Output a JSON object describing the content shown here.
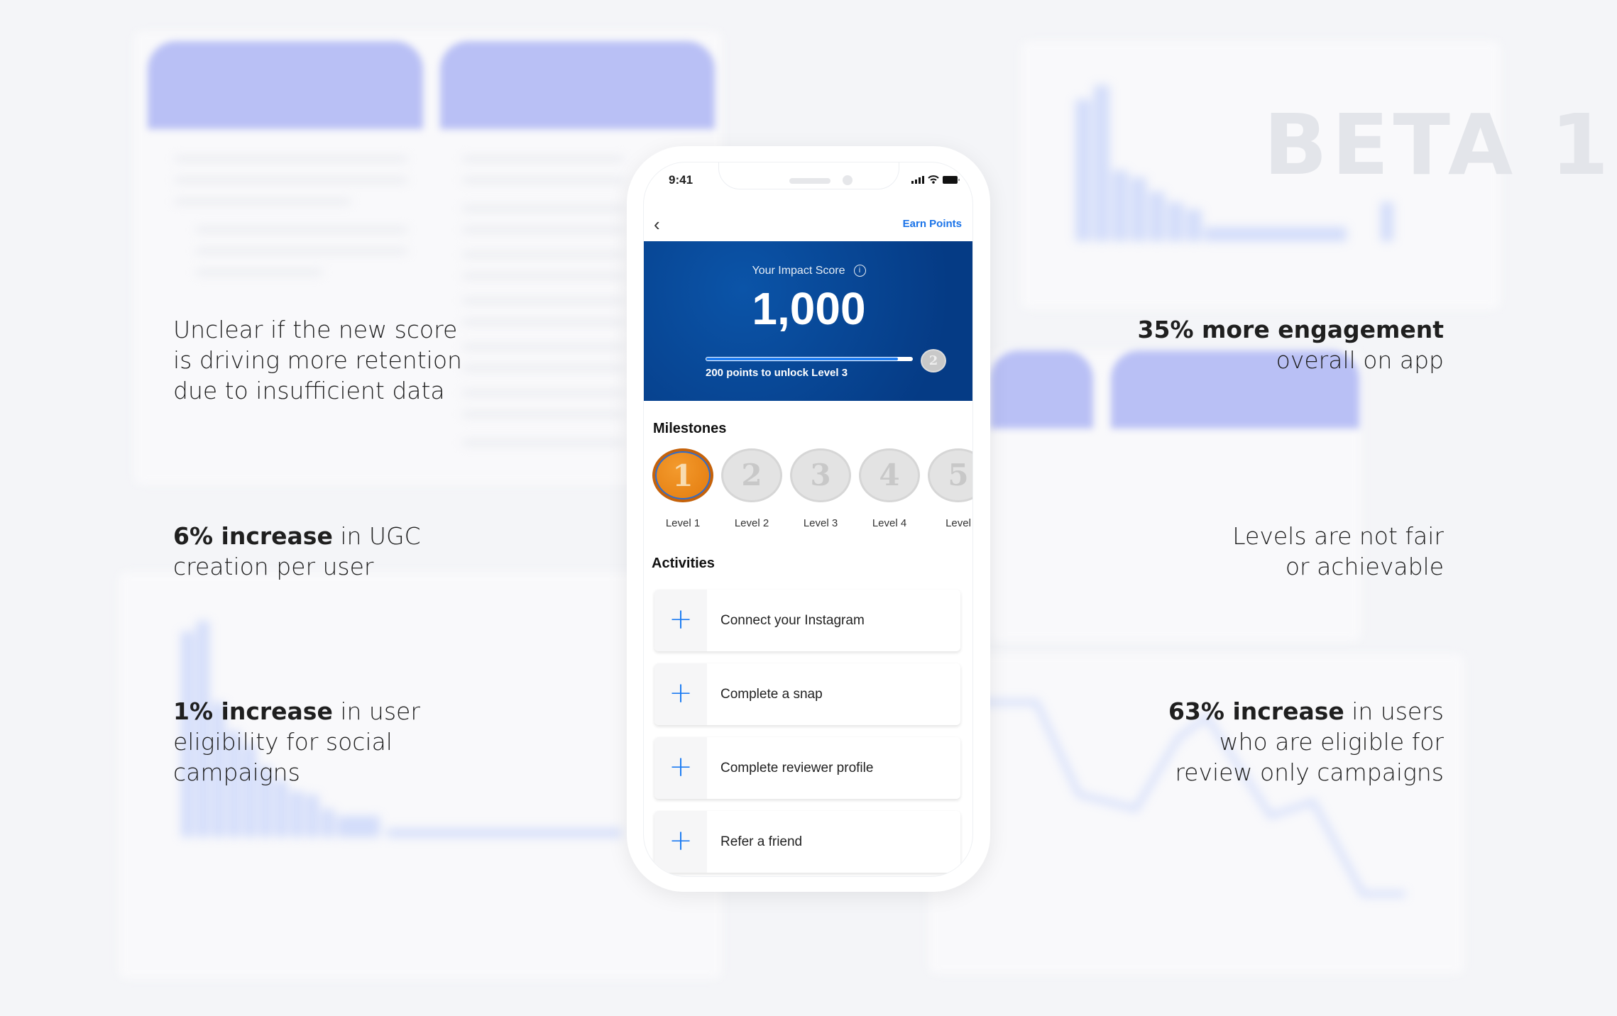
{
  "watermark": "BETA 1",
  "notes": [
    {
      "bold": "",
      "text": "Unclear if the new score is driving more retention due to insufficient data"
    },
    {
      "bold": "35% more engagement",
      "text": " overall on app"
    },
    {
      "bold": "6% increase",
      "text": " in UGC creation per user"
    },
    {
      "bold": "",
      "text": "Levels are not fair or achievable"
    },
    {
      "bold": "1% increase",
      "text": " in user eligibility for social campaigns"
    },
    {
      "bold": "63% increase",
      "text": " in users who are eligible for review only campaigns"
    }
  ],
  "phone": {
    "time": "9:41",
    "back_icon": "chevron-left",
    "earn_points": "Earn Points",
    "banner": {
      "label": "Your Impact Score",
      "info_icon": "i",
      "score": "1,000",
      "progress_fraction": 0.93,
      "next_level_badge": "2",
      "progress_label": "200 points to unlock Level 3"
    },
    "milestones_title": "Milestones",
    "milestones": [
      {
        "num": "1",
        "label": "Level 1",
        "achieved": true
      },
      {
        "num": "2",
        "label": "Level 2",
        "achieved": false
      },
      {
        "num": "3",
        "label": "Level 3",
        "achieved": false
      },
      {
        "num": "4",
        "label": "Level 4",
        "achieved": false
      },
      {
        "num": "5",
        "label": "Level",
        "achieved": false
      }
    ],
    "activities_title": "Activities",
    "activities": [
      {
        "icon": "+",
        "label": "Connect your Instagram"
      },
      {
        "icon": "+",
        "label": "Complete a snap"
      },
      {
        "icon": "+",
        "label": "Complete reviewer profile"
      },
      {
        "icon": "+",
        "label": "Refer a friend"
      }
    ]
  },
  "colors": {
    "accent": "#1a73e8",
    "banner": "#053b85",
    "medal_gold": "#e37a0c",
    "lavender": "#b9c0f5"
  }
}
